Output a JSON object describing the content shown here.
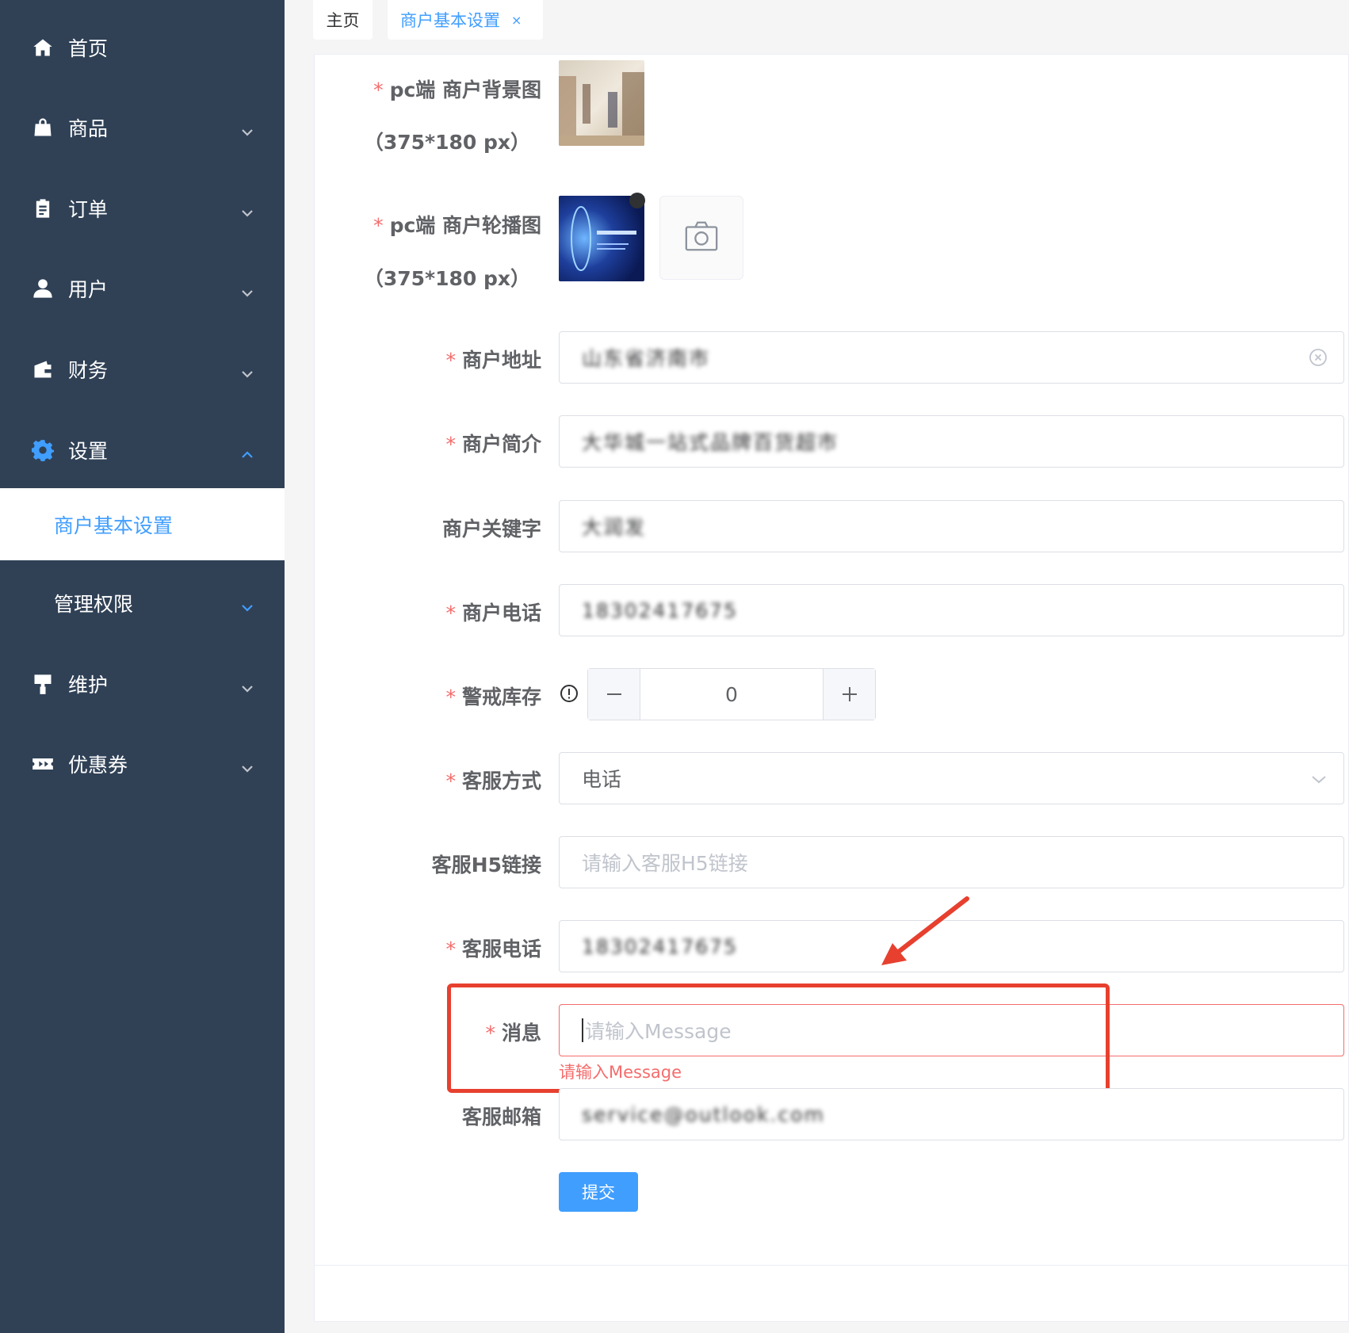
{
  "sidebar": {
    "items": [
      {
        "label": "首页",
        "icon": "home-icon"
      },
      {
        "label": "商品",
        "icon": "shopping-bag-icon"
      },
      {
        "label": "订单",
        "icon": "clipboard-icon"
      },
      {
        "label": "用户",
        "icon": "user-icon"
      },
      {
        "label": "财务",
        "icon": "wallet-icon"
      },
      {
        "label": "设置",
        "icon": "gear-icon"
      },
      {
        "label": "维护",
        "icon": "paint-roller-icon"
      },
      {
        "label": "优惠券",
        "icon": "ticket-icon"
      }
    ],
    "active_sub": "商户基本设置",
    "sub_item": "管理权限"
  },
  "tabs": {
    "home": "主页",
    "current": "商户基本设置",
    "close": "×"
  },
  "form": {
    "bg_image": {
      "label_1": "pc端 商户背景图",
      "label_2": "（375*180 px）"
    },
    "carousel": {
      "label_1": "pc端 商户轮播图",
      "label_2": "（375*180 px）"
    },
    "address": {
      "label": "商户地址",
      "value": "山东省济南市"
    },
    "intro": {
      "label": "商户简介",
      "value": "大华城一站式品牌百货超市"
    },
    "keyword": {
      "label": "商户关键字",
      "value": "大润发"
    },
    "phone": {
      "label": "商户电话",
      "value": "18302417675"
    },
    "stock": {
      "label": "警戒库存",
      "value": "0"
    },
    "service_method": {
      "label": "客服方式",
      "value": "电话"
    },
    "h5_link": {
      "label": "客服H5链接",
      "placeholder": "请输入客服H5链接"
    },
    "service_phone": {
      "label": "客服电话",
      "value": "18302417675"
    },
    "message": {
      "label": "消息",
      "placeholder": "请输入Message",
      "error": "请输入Message"
    },
    "email": {
      "label": "客服邮箱",
      "value": "service@outlook.com"
    },
    "submit": "提交"
  },
  "colors": {
    "sidebar_bg": "#304156",
    "accent": "#409eff",
    "error": "#f56c6c",
    "annotation": "#e7402f"
  }
}
